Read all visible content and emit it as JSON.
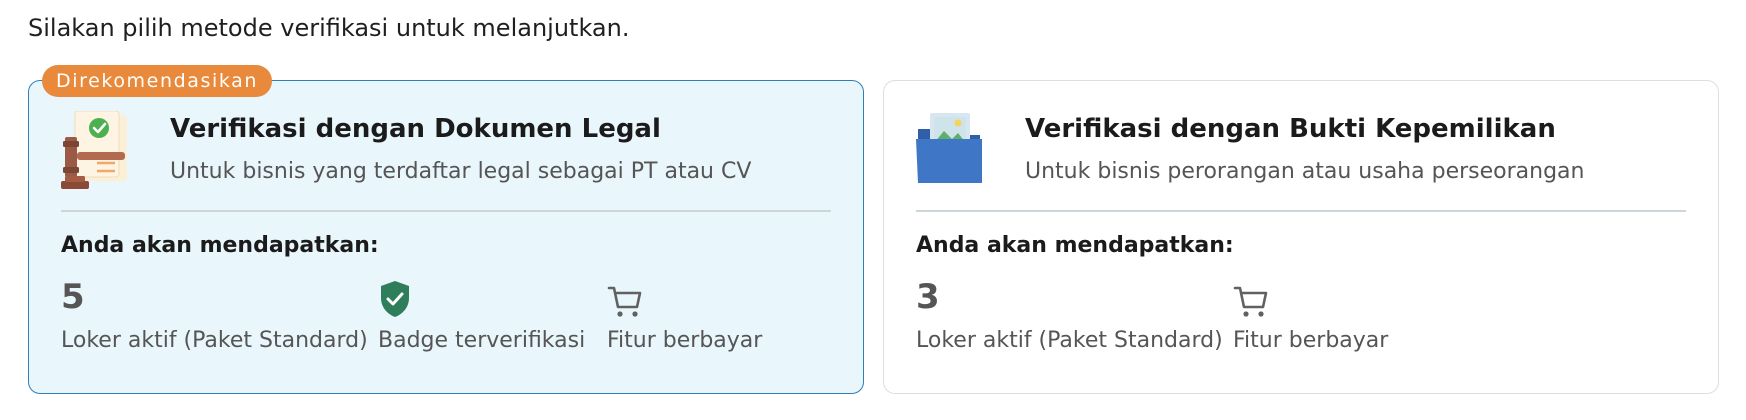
{
  "instruction": "Silakan pilih metode verifikasi untuk melanjutkan.",
  "cards": [
    {
      "badge": "Direkomendasikan",
      "illustration": "legal-document-gavel-icon",
      "title": "Verifikasi dengan Dokumen Legal",
      "subtitle": "Untuk bisnis yang terdaftar legal sebagai PT atau CV",
      "benefits_heading": "Anda akan mendapatkan:",
      "benefits": [
        {
          "value": "5",
          "label": "Loker aktif (Paket Standard)"
        },
        {
          "icon": "verified-shield-icon",
          "label": "Badge terverifikasi"
        },
        {
          "icon": "cart-icon",
          "label": "Fitur berbayar"
        }
      ]
    },
    {
      "illustration": "photo-folder-icon",
      "title": "Verifikasi dengan Bukti Kepemilikan",
      "subtitle": "Untuk bisnis perorangan atau usaha perseorangan",
      "benefits_heading": "Anda akan mendapatkan:",
      "benefits": [
        {
          "value": "3",
          "label": "Loker aktif (Paket Standard)"
        },
        {
          "icon": "cart-icon",
          "label": "Fitur berbayar"
        }
      ]
    }
  ],
  "colors": {
    "recommended_badge": "#e9893b",
    "selected_card_bg": "#e9f6fc",
    "selected_card_border": "#2f7eb9",
    "verified_shield": "#2e7d5b"
  }
}
